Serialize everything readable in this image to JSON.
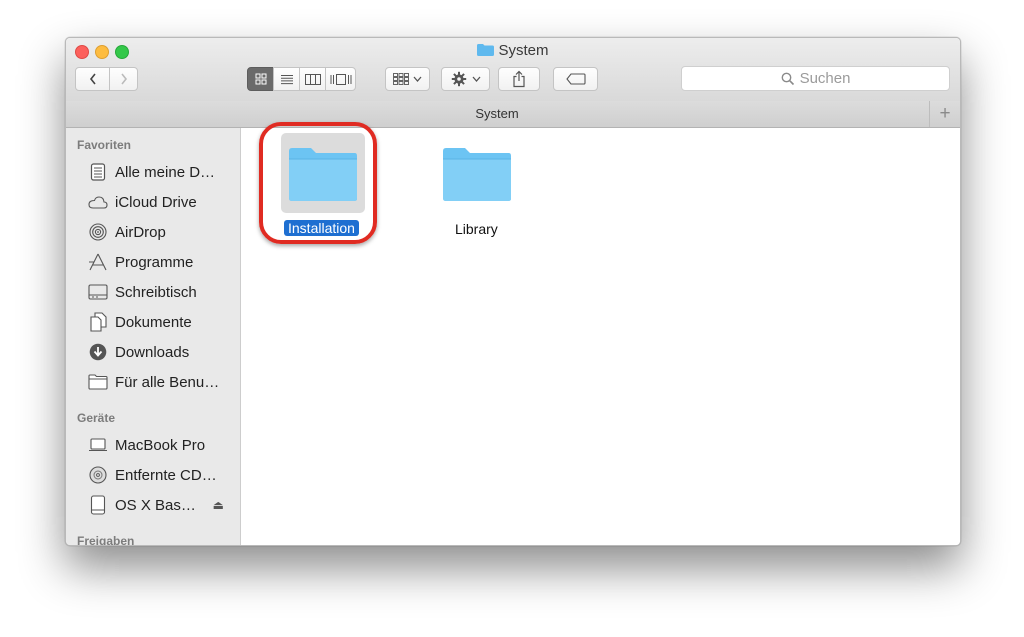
{
  "window": {
    "title": "System",
    "traffic_lights": {
      "close": "#fc605c",
      "minimize": "#fdbc40",
      "zoom": "#34c84a"
    }
  },
  "toolbar": {
    "back_icon": "chevron-left-icon",
    "forward_icon": "chevron-right-icon",
    "view_modes": [
      "icon-view-icon",
      "list-view-icon",
      "column-view-icon",
      "cover-flow-icon"
    ],
    "active_view": "icon-view-icon",
    "arrange_icon": "arrange-grid-icon",
    "action_icon": "gear-icon",
    "share_icon": "share-icon",
    "tag_icon": "tag-icon",
    "search_placeholder": "Suchen"
  },
  "tabbar": {
    "label": "System",
    "add_icon": "plus-icon"
  },
  "sidebar": {
    "sections": [
      {
        "title": "Favoriten",
        "items": [
          {
            "label": "Alle meine D…",
            "icon": "all-files-icon"
          },
          {
            "label": "iCloud Drive",
            "icon": "cloud-icon"
          },
          {
            "label": "AirDrop",
            "icon": "airdrop-icon"
          },
          {
            "label": "Programme",
            "icon": "applications-icon"
          },
          {
            "label": "Schreibtisch",
            "icon": "desktop-icon"
          },
          {
            "label": "Dokumente",
            "icon": "documents-icon"
          },
          {
            "label": "Downloads",
            "icon": "downloads-icon"
          },
          {
            "label": "Für alle Benu…",
            "icon": "folder-icon"
          }
        ]
      },
      {
        "title": "Geräte",
        "items": [
          {
            "label": "MacBook Pro",
            "icon": "laptop-icon"
          },
          {
            "label": "Entfernte CD…",
            "icon": "disc-icon"
          },
          {
            "label": "OS X Bas…",
            "icon": "drive-icon",
            "eject": "⏏"
          }
        ]
      },
      {
        "title": "Freigaben",
        "items": []
      }
    ]
  },
  "content": {
    "items": [
      {
        "name": "Installation",
        "icon": "folder-icon",
        "selected": true
      },
      {
        "name": "Library",
        "icon": "folder-icon",
        "selected": false
      }
    ]
  },
  "colors": {
    "accent": "#1e6fd1",
    "folder": "#6cc4f3",
    "annotation": "#e02b22"
  }
}
